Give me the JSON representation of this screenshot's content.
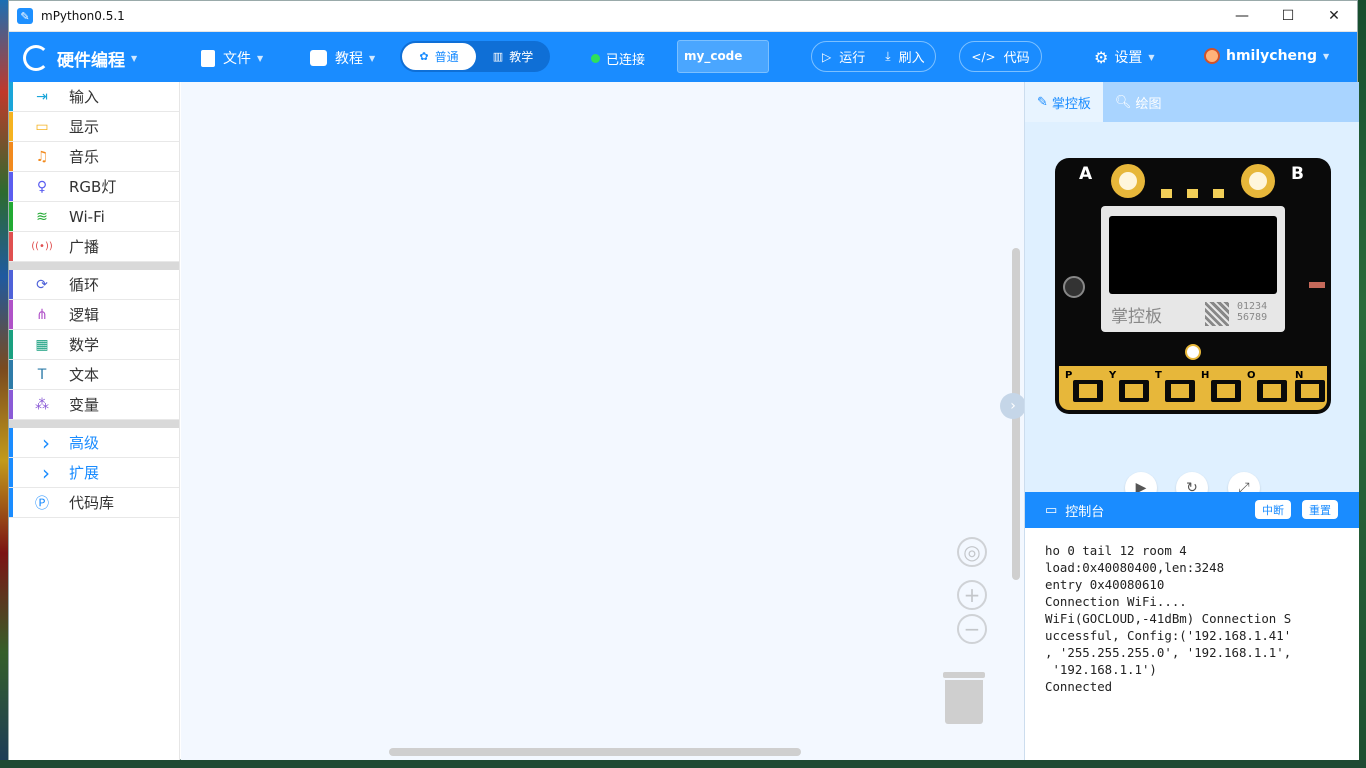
{
  "window": {
    "title": "mPython0.5.1"
  },
  "toolbar": {
    "brand": "硬件编程",
    "file_label": "文件",
    "tutorial_label": "教程",
    "mode_normal": "普通",
    "mode_teach": "教学",
    "status": "已连接",
    "project_name": "my_code",
    "run_label": "运行",
    "flash_label": "刷入",
    "code_label": "代码",
    "settings_label": "设置",
    "username": "hmilycheng"
  },
  "sidebar": {
    "items": [
      {
        "label": "输入",
        "icon": "input-icon",
        "color": "#1aa5d9"
      },
      {
        "label": "显示",
        "icon": "display-icon",
        "color": "#f5b320"
      },
      {
        "label": "音乐",
        "icon": "music-icon",
        "color": "#f28a1e"
      },
      {
        "label": "RGB灯",
        "icon": "bulb-icon",
        "color": "#5b5ef0"
      },
      {
        "label": "Wi-Fi",
        "icon": "wifi-icon",
        "color": "#22aa33"
      },
      {
        "label": "广播",
        "icon": "broadcast-icon",
        "color": "#e05050"
      },
      {
        "label": "循环",
        "icon": "loop-icon",
        "color": "#4f62d9"
      },
      {
        "label": "逻辑",
        "icon": "logic-icon",
        "color": "#b052c8"
      },
      {
        "label": "数学",
        "icon": "math-icon",
        "color": "#1aa080"
      },
      {
        "label": "文本",
        "icon": "text-icon",
        "color": "#2e7ba8"
      },
      {
        "label": "变量",
        "icon": "variable-icon",
        "color": "#8a5ad6"
      },
      {
        "label": "高级",
        "icon": "chevron-right-icon",
        "color": "#1a8cff"
      },
      {
        "label": "扩展",
        "icon": "chevron-right-icon",
        "color": "#1a8cff"
      },
      {
        "label": "代码库",
        "icon": "library-icon",
        "color": "#1a8cff"
      }
    ]
  },
  "right_panel": {
    "tab_board": "掌控板",
    "tab_draw": "绘图",
    "board_label_a": "A",
    "board_label_b": "B",
    "oled_text": "掌控板",
    "oled_num_1": "01234",
    "oled_num_2": "56789",
    "pin_labels": [
      "P",
      "Y",
      "T",
      "H",
      "O",
      "N"
    ],
    "console_title": "控制台",
    "console_btn_interrupt": "中断",
    "console_btn_reset": "重置",
    "console_lines": [
      "ho 0 tail 12 room 4",
      "load:0x40080400,len:3248",
      "entry 0x40080610",
      "Connection WiFi....",
      "WiFi(GOCLOUD,-41dBm) Connection S",
      "uccessful, Config:('192.168.1.41'",
      ", '255.255.255.0', '192.168.1.1',",
      " '192.168.1.1')",
      "Connected"
    ]
  }
}
